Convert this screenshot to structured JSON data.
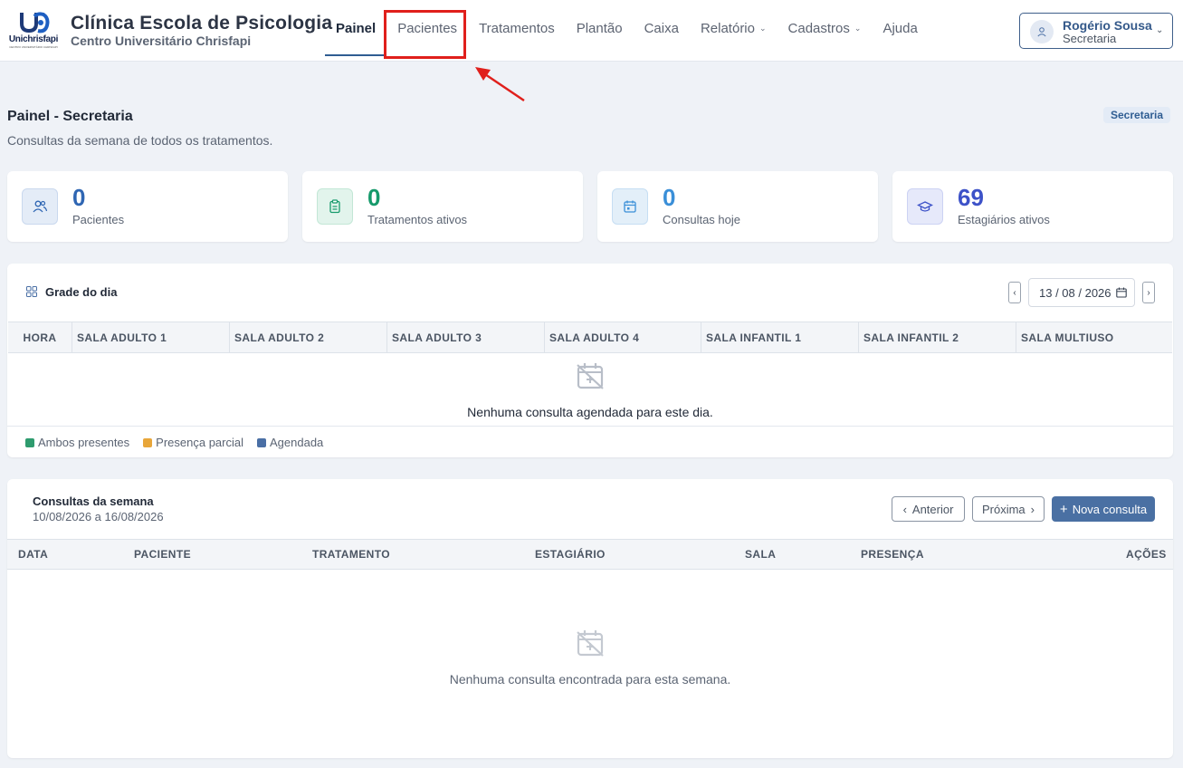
{
  "header": {
    "logo_text": "Unichrisfapi",
    "logo_subtext": "CENTRO UNIVERSITÁRIO CHRISFAPI",
    "brand_title": "Clínica Escola de Psicologia",
    "brand_subtitle": "Centro Universitário Chrisfapi",
    "nav": [
      {
        "label": "Painel",
        "active": true
      },
      {
        "label": "Pacientes"
      },
      {
        "label": "Tratamentos"
      },
      {
        "label": "Plantão"
      },
      {
        "label": "Caixa"
      },
      {
        "label": "Relatório",
        "dropdown": true
      },
      {
        "label": "Cadastros",
        "dropdown": true
      },
      {
        "label": "Ajuda"
      }
    ],
    "user": {
      "name": "Rogério Sousa",
      "role": "Secretaria"
    }
  },
  "page": {
    "title": "Painel - Secretaria",
    "subtitle": "Consultas da semana de todos os tratamentos.",
    "badge": "Secretaria"
  },
  "stats": [
    {
      "value": "0",
      "label": "Pacientes",
      "icon": "users-icon",
      "color": "#2f66b3"
    },
    {
      "value": "0",
      "label": "Tratamentos ativos",
      "icon": "clipboard-icon",
      "color": "#169a6b"
    },
    {
      "value": "0",
      "label": "Consultas hoje",
      "icon": "calendar-icon",
      "color": "#3a8fd8"
    },
    {
      "value": "69",
      "label": "Estagiários ativos",
      "icon": "graduation-cap-icon",
      "color": "#3d52c8"
    }
  ],
  "grid": {
    "title": "Grade do dia",
    "date": "13 / 08 / 2026",
    "columns": [
      "HORA",
      "SALA ADULTO 1",
      "SALA ADULTO 2",
      "SALA ADULTO 3",
      "SALA ADULTO 4",
      "SALA INFANTIL 1",
      "SALA INFANTIL 2",
      "SALA MULTIUSO"
    ],
    "empty_text": "Nenhuma consulta agendada para este dia.",
    "legend": [
      {
        "label": "Ambos presentes",
        "color": "#2e9b6e"
      },
      {
        "label": "Presença parcial",
        "color": "#e8a63a"
      },
      {
        "label": "Agendada",
        "color": "#4a6fa5"
      }
    ]
  },
  "week": {
    "title": "Consultas da semana",
    "range": "10/08/2026 a 16/08/2026",
    "prev_label": "Anterior",
    "next_label": "Próxima",
    "new_label": "Nova consulta",
    "columns": [
      "DATA",
      "PACIENTE",
      "TRATAMENTO",
      "ESTAGIÁRIO",
      "SALA",
      "PRESENÇA",
      "AÇÕES"
    ],
    "empty_text": "Nenhuma consulta encontrada para esta semana."
  }
}
